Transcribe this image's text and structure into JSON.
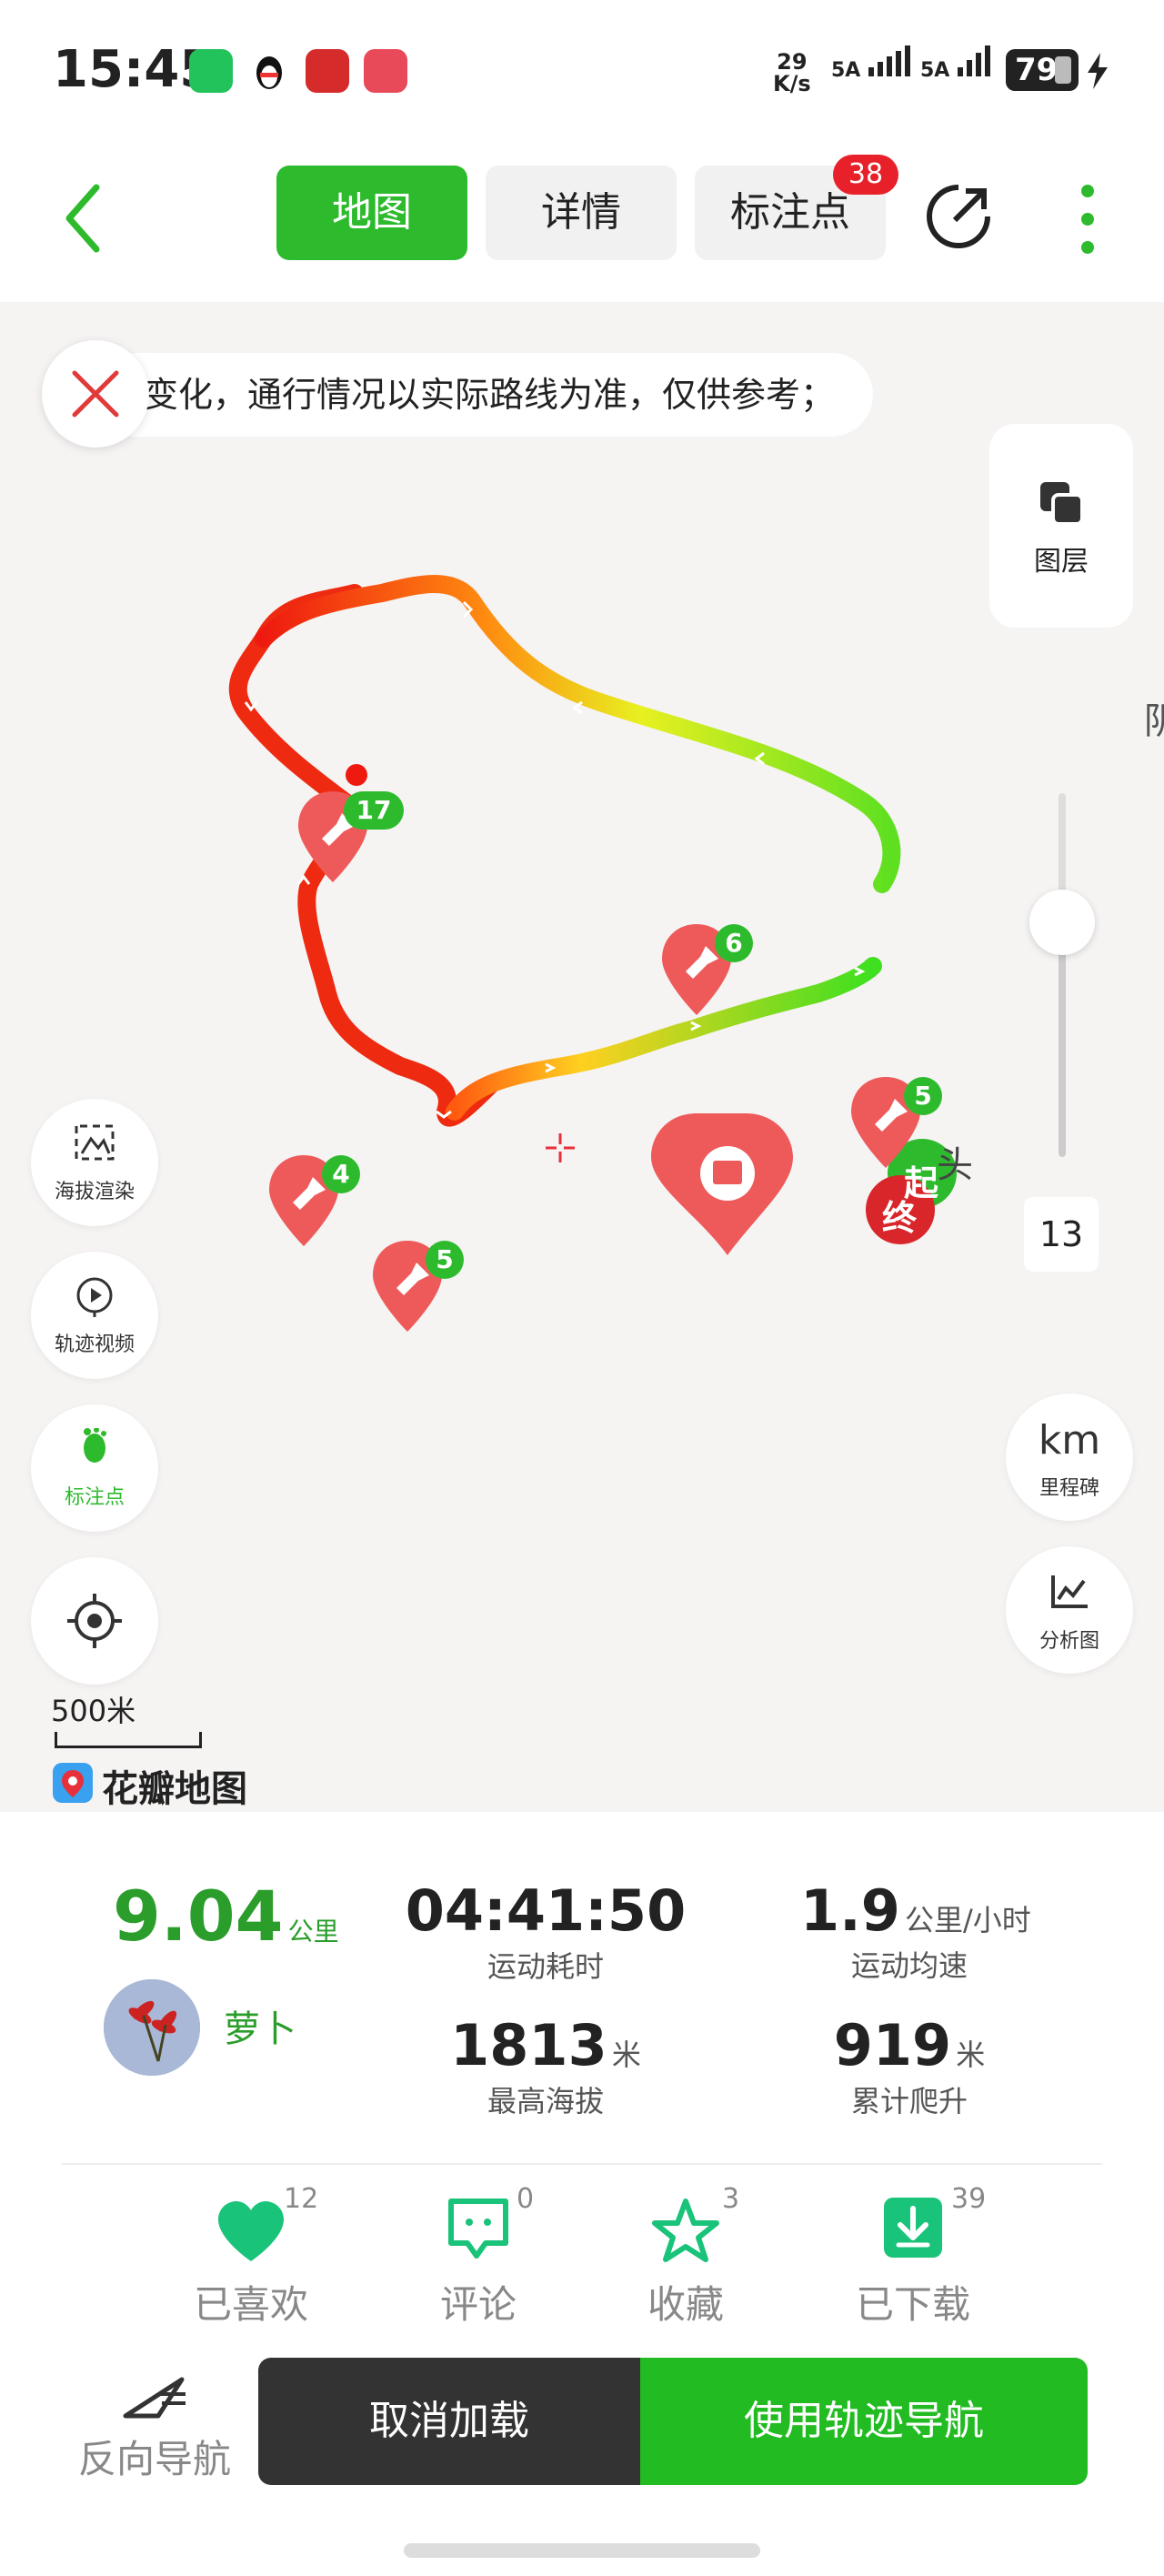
{
  "status_bar": {
    "time": "15:45",
    "net_speed_value": "29",
    "net_speed_unit": "K/s",
    "signal1": "5A",
    "signal2": "5A",
    "battery": "79"
  },
  "nav": {
    "tabs": [
      {
        "label": "地图",
        "active": true
      },
      {
        "label": "详情",
        "active": false
      },
      {
        "label": "标注点",
        "active": false
      }
    ],
    "badge": "38"
  },
  "map": {
    "notice": "变化，通行情况以实际路线为准，仅供参考；",
    "layer_label": "图层",
    "side_text": "阴",
    "buttons_left": [
      {
        "label": "海拔渲染",
        "icon": "elevation-icon"
      },
      {
        "label": "轨迹视频",
        "icon": "play-icon"
      },
      {
        "label": "标注点",
        "icon": "footprint-icon"
      }
    ],
    "buttons_right": [
      {
        "label": "里程碑",
        "icon_text": "km"
      },
      {
        "label": "分析图",
        "icon": "chart-icon"
      }
    ],
    "zoom_level": "13",
    "scale": "500米",
    "brand": "花瓣地图",
    "markers": [
      {
        "count": "17"
      },
      {
        "count": "6"
      },
      {
        "count": "5"
      },
      {
        "count": "4"
      },
      {
        "count": "5"
      }
    ],
    "start_label": "起",
    "end_label": "终",
    "place_text": "头"
  },
  "stats": {
    "distance": "9.04",
    "distance_unit": "公里",
    "duration": "04:41:50",
    "duration_label": "运动耗时",
    "speed": "1.9",
    "speed_unit": "公里/小时",
    "speed_label": "运动均速",
    "user_name": "萝卜",
    "max_alt": "1813",
    "max_alt_unit": "米",
    "max_alt_label": "最高海拔",
    "climb": "919",
    "climb_unit": "米",
    "climb_label": "累计爬升"
  },
  "actions": [
    {
      "label": "已喜欢",
      "count": "12",
      "icon": "heart-icon"
    },
    {
      "label": "评论",
      "count": "0",
      "icon": "comment-icon"
    },
    {
      "label": "收藏",
      "count": "3",
      "icon": "star-icon"
    },
    {
      "label": "已下载",
      "count": "39",
      "icon": "download-icon"
    }
  ],
  "bottom": {
    "reverse_nav": "反向导航",
    "cancel": "取消加载",
    "use_nav": "使用轨迹导航"
  },
  "colors": {
    "accent": "#2dbb2d",
    "marker": "#ee5a5a",
    "dark_button": "#333333"
  }
}
